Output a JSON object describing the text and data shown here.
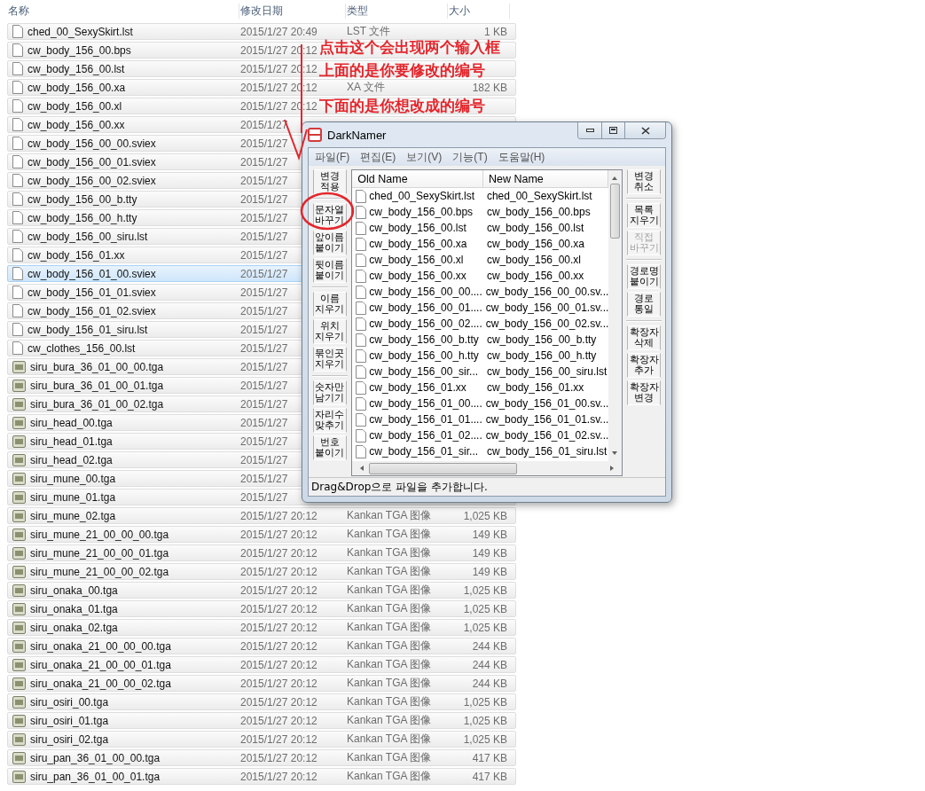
{
  "explorer": {
    "columns": [
      "名称",
      "修改日期",
      "类型",
      "大小"
    ],
    "rows": [
      {
        "name": "ched_00_SexySkirt.lst",
        "date": "2015/1/27 20:49",
        "type": "LST 文件",
        "size": "1 KB",
        "kind": "file",
        "selected": false
      },
      {
        "name": "cw_body_156_00.bps",
        "date": "2015/1/27 20:12",
        "kind": "file",
        "selected": false
      },
      {
        "name": "cw_body_156_00.lst",
        "date": "2015/1/27 20:12",
        "kind": "file",
        "selected": false
      },
      {
        "name": "cw_body_156_00.xa",
        "date": "2015/1/27 20:12",
        "type": "XA 文件",
        "size": "182 KB",
        "kind": "file",
        "selected": false
      },
      {
        "name": "cw_body_156_00.xl",
        "date": "2015/1/27 20:12",
        "kind": "file",
        "selected": false
      },
      {
        "name": "cw_body_156_00.xx",
        "date": "2015/1/27",
        "kind": "file",
        "selected": false
      },
      {
        "name": "cw_body_156_00_00.sviex",
        "date": "2015/1/27",
        "kind": "file",
        "selected": false
      },
      {
        "name": "cw_body_156_00_01.sviex",
        "date": "2015/1/27",
        "kind": "file",
        "selected": false
      },
      {
        "name": "cw_body_156_00_02.sviex",
        "date": "2015/1/27",
        "kind": "file",
        "selected": false
      },
      {
        "name": "cw_body_156_00_b.tty",
        "date": "2015/1/27",
        "kind": "file",
        "selected": false
      },
      {
        "name": "cw_body_156_00_h.tty",
        "date": "2015/1/27",
        "kind": "file",
        "selected": false
      },
      {
        "name": "cw_body_156_00_siru.lst",
        "date": "2015/1/27",
        "kind": "file",
        "selected": false
      },
      {
        "name": "cw_body_156_01.xx",
        "date": "2015/1/27",
        "kind": "file",
        "selected": false
      },
      {
        "name": "cw_body_156_01_00.sviex",
        "date": "2015/1/27",
        "kind": "file",
        "selected": true
      },
      {
        "name": "cw_body_156_01_01.sviex",
        "date": "2015/1/27",
        "kind": "file",
        "selected": false
      },
      {
        "name": "cw_body_156_01_02.sviex",
        "date": "2015/1/27",
        "kind": "file",
        "selected": false
      },
      {
        "name": "cw_body_156_01_siru.lst",
        "date": "2015/1/27",
        "kind": "file",
        "selected": false
      },
      {
        "name": "cw_clothes_156_00.lst",
        "date": "2015/1/27",
        "kind": "file",
        "selected": false
      },
      {
        "name": "siru_bura_36_01_00_00.tga",
        "date": "2015/1/27",
        "kind": "tga",
        "selected": false
      },
      {
        "name": "siru_bura_36_01_00_01.tga",
        "date": "2015/1/27",
        "kind": "tga",
        "selected": false
      },
      {
        "name": "siru_bura_36_01_00_02.tga",
        "date": "2015/1/27",
        "kind": "tga",
        "selected": false
      },
      {
        "name": "siru_head_00.tga",
        "date": "2015/1/27",
        "kind": "tga",
        "selected": false
      },
      {
        "name": "siru_head_01.tga",
        "date": "2015/1/27",
        "kind": "tga",
        "selected": false
      },
      {
        "name": "siru_head_02.tga",
        "date": "2015/1/27",
        "kind": "tga",
        "selected": false
      },
      {
        "name": "siru_mune_00.tga",
        "date": "2015/1/27",
        "kind": "tga",
        "selected": false
      },
      {
        "name": "siru_mune_01.tga",
        "date": "2015/1/27",
        "kind": "tga",
        "selected": false
      },
      {
        "name": "siru_mune_02.tga",
        "date": "2015/1/27 20:12",
        "type": "Kankan TGA 图像",
        "size": "1,025 KB",
        "kind": "tga",
        "selected": false
      },
      {
        "name": "siru_mune_21_00_00_00.tga",
        "date": "2015/1/27 20:12",
        "type": "Kankan TGA 图像",
        "size": "149 KB",
        "kind": "tga",
        "selected": false
      },
      {
        "name": "siru_mune_21_00_00_01.tga",
        "date": "2015/1/27 20:12",
        "type": "Kankan TGA 图像",
        "size": "149 KB",
        "kind": "tga",
        "selected": false
      },
      {
        "name": "siru_mune_21_00_00_02.tga",
        "date": "2015/1/27 20:12",
        "type": "Kankan TGA 图像",
        "size": "149 KB",
        "kind": "tga",
        "selected": false
      },
      {
        "name": "siru_onaka_00.tga",
        "date": "2015/1/27 20:12",
        "type": "Kankan TGA 图像",
        "size": "1,025 KB",
        "kind": "tga",
        "selected": false
      },
      {
        "name": "siru_onaka_01.tga",
        "date": "2015/1/27 20:12",
        "type": "Kankan TGA 图像",
        "size": "1,025 KB",
        "kind": "tga",
        "selected": false
      },
      {
        "name": "siru_onaka_02.tga",
        "date": "2015/1/27 20:12",
        "type": "Kankan TGA 图像",
        "size": "1,025 KB",
        "kind": "tga",
        "selected": false
      },
      {
        "name": "siru_onaka_21_00_00_00.tga",
        "date": "2015/1/27 20:12",
        "type": "Kankan TGA 图像",
        "size": "244 KB",
        "kind": "tga",
        "selected": false
      },
      {
        "name": "siru_onaka_21_00_00_01.tga",
        "date": "2015/1/27 20:12",
        "type": "Kankan TGA 图像",
        "size": "244 KB",
        "kind": "tga",
        "selected": false
      },
      {
        "name": "siru_onaka_21_00_00_02.tga",
        "date": "2015/1/27 20:12",
        "type": "Kankan TGA 图像",
        "size": "244 KB",
        "kind": "tga",
        "selected": false
      },
      {
        "name": "siru_osiri_00.tga",
        "date": "2015/1/27 20:12",
        "type": "Kankan TGA 图像",
        "size": "1,025 KB",
        "kind": "tga",
        "selected": false
      },
      {
        "name": "siru_osiri_01.tga",
        "date": "2015/1/27 20:12",
        "type": "Kankan TGA 图像",
        "size": "1,025 KB",
        "kind": "tga",
        "selected": false
      },
      {
        "name": "siru_osiri_02.tga",
        "date": "2015/1/27 20:12",
        "type": "Kankan TGA 图像",
        "size": "1,025 KB",
        "kind": "tga",
        "selected": false
      },
      {
        "name": "siru_pan_36_01_00_00.tga",
        "date": "2015/1/27 20:12",
        "type": "Kankan TGA 图像",
        "size": "417 KB",
        "kind": "tga",
        "selected": false
      },
      {
        "name": "siru_pan_36_01_00_01.tga",
        "date": "2015/1/27 20:12",
        "type": "Kankan TGA 图像",
        "size": "417 KB",
        "kind": "tga",
        "selected": false
      }
    ]
  },
  "annotations": [
    "点击这个会出现两个输入框",
    "上面的是你要修改的编号",
    "下面的是你想改成的编号"
  ],
  "window": {
    "title": "DarkNamer",
    "menu": [
      "파일(F)",
      "편집(E)",
      "보기(V)",
      "기능(T)",
      "도움말(H)"
    ],
    "left_groups": [
      {
        "buttons": [
          {
            "label": "변경 적용",
            "disabled": false
          }
        ]
      },
      {
        "buttons": [
          {
            "label": "문자열 바꾸기",
            "disabled": false
          },
          {
            "label": "앞이름 붙이기",
            "disabled": false
          },
          {
            "label": "뒷이름 붙이기",
            "disabled": false
          }
        ]
      },
      {
        "buttons": [
          {
            "label": "이름 지우기",
            "disabled": false
          },
          {
            "label": "위치 지우기",
            "disabled": false
          },
          {
            "label": "묶인곳 지우기",
            "disabled": false
          }
        ]
      },
      {
        "buttons": [
          {
            "label": "숫자만 남기기",
            "disabled": false
          },
          {
            "label": "자리수 맞추기",
            "disabled": false
          },
          {
            "label": "번호 붙이기",
            "disabled": false
          }
        ]
      }
    ],
    "right_groups": [
      {
        "buttons": [
          {
            "label": "변경 취소",
            "disabled": false
          }
        ]
      },
      {
        "buttons": [
          {
            "label": "목록 지우기",
            "disabled": false
          },
          {
            "label": "직접 바꾸기",
            "disabled": true
          }
        ]
      },
      {
        "buttons": [
          {
            "label": "경로명 붙이기",
            "disabled": false
          },
          {
            "label": "경로 통일",
            "disabled": false
          }
        ]
      },
      {
        "buttons": [
          {
            "label": "확장자 삭제",
            "disabled": false
          },
          {
            "label": "확장자 추가",
            "disabled": false
          },
          {
            "label": "확장자 변경",
            "disabled": false
          }
        ]
      }
    ],
    "list": {
      "columns": [
        "Old Name",
        "New Name"
      ],
      "rows": [
        {
          "old_name": "ched_00_SexySkirt.lst",
          "new_name": "ched_00_SexySkirt.lst"
        },
        {
          "old_name": "cw_body_156_00.bps",
          "new_name": "cw_body_156_00.bps"
        },
        {
          "old_name": "cw_body_156_00.lst",
          "new_name": "cw_body_156_00.lst"
        },
        {
          "old_name": "cw_body_156_00.xa",
          "new_name": "cw_body_156_00.xa"
        },
        {
          "old_name": "cw_body_156_00.xl",
          "new_name": "cw_body_156_00.xl"
        },
        {
          "old_name": "cw_body_156_00.xx",
          "new_name": "cw_body_156_00.xx"
        },
        {
          "old_name": "cw_body_156_00_00....",
          "new_name": "cw_body_156_00_00.sv..."
        },
        {
          "old_name": "cw_body_156_00_01....",
          "new_name": "cw_body_156_00_01.sv..."
        },
        {
          "old_name": "cw_body_156_00_02....",
          "new_name": "cw_body_156_00_02.sv..."
        },
        {
          "old_name": "cw_body_156_00_b.tty",
          "new_name": "cw_body_156_00_b.tty"
        },
        {
          "old_name": "cw_body_156_00_h.tty",
          "new_name": "cw_body_156_00_h.tty"
        },
        {
          "old_name": "cw_body_156_00_sir...",
          "new_name": "cw_body_156_00_siru.lst"
        },
        {
          "old_name": "cw_body_156_01.xx",
          "new_name": "cw_body_156_01.xx"
        },
        {
          "old_name": "cw_body_156_01_00....",
          "new_name": "cw_body_156_01_00.sv..."
        },
        {
          "old_name": "cw_body_156_01_01....",
          "new_name": "cw_body_156_01_01.sv..."
        },
        {
          "old_name": "cw_body_156_01_02....",
          "new_name": "cw_body_156_01_02.sv..."
        },
        {
          "old_name": "cw_body_156_01_sir...",
          "new_name": "cw_body_156_01_siru.lst"
        }
      ]
    },
    "status": "Drag&Drop으로 파일을 추가합니다."
  }
}
